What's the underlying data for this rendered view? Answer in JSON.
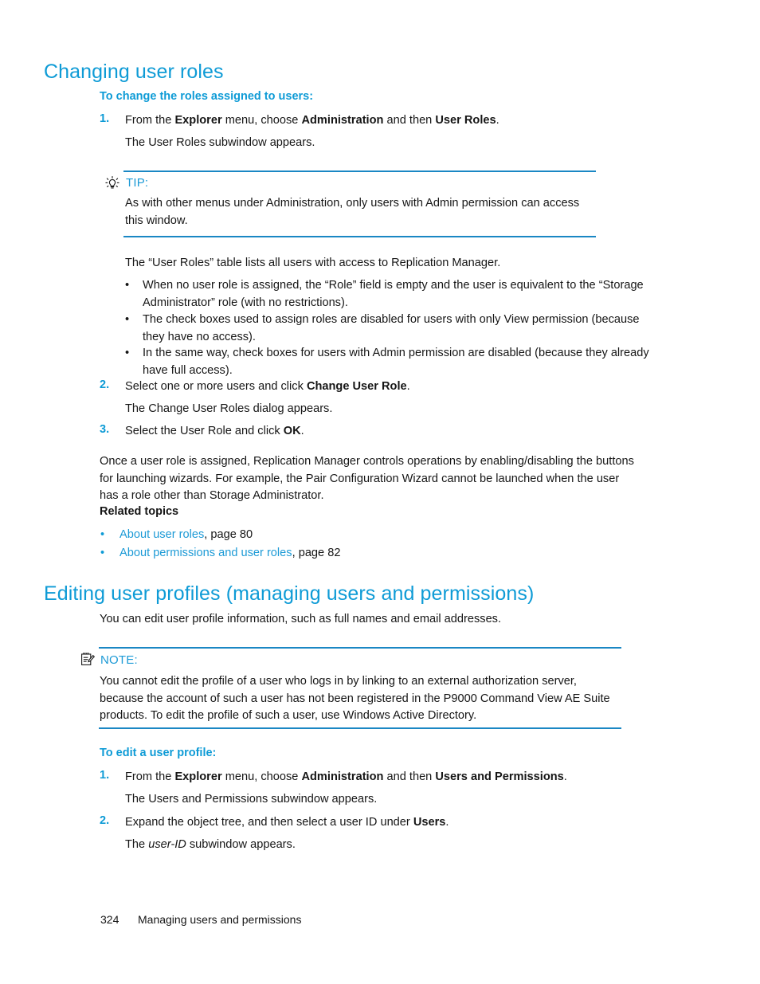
{
  "section1": {
    "heading": "Changing user roles",
    "procedure_heading": "To change the roles assigned to users:",
    "step1": {
      "number": "1.",
      "lead": "From the ",
      "bold1": "Explorer",
      "mid1": " menu, choose ",
      "bold2": "Administration",
      "mid2": " and then ",
      "bold3": "User Roles",
      "tail": ".",
      "result": "The User Roles subwindow appears."
    },
    "tip": {
      "icon": "lightbulb-icon",
      "label": "TIP:",
      "body": "As with other menus under Administration, only users with Admin permission can access this window."
    },
    "intro": "The “User Roles” table lists all users with access to Replication Manager.",
    "bullets": [
      "When no user role is assigned, the “Role” field is empty and the user is equivalent to the “Storage Administrator” role (with no restrictions).",
      "The check boxes used to assign roles are disabled for users with only View permission (because they have no access).",
      "In the same way, check boxes for users with Admin permission are disabled (because they already have full access)."
    ],
    "step2": {
      "number": "2.",
      "lead": "Select one or more users and click ",
      "bold1": "Change User Role",
      "tail": ".",
      "result": "The Change User Roles dialog appears."
    },
    "step3": {
      "number": "3.",
      "lead": "Select the User Role and click ",
      "bold1": "OK",
      "tail": "."
    },
    "closing_paragraph": "Once a user role is assigned, Replication Manager controls operations by enabling/disabling the buttons for launching wizards. For example, the Pair Configuration Wizard cannot be launched when the user has a role other than Storage Administrator.",
    "related_topics": {
      "heading": "Related topics",
      "items": [
        {
          "link": "About user roles",
          "page": ", page 80"
        },
        {
          "link": "About permissions and user roles",
          "page": ", page 82"
        }
      ]
    }
  },
  "section2": {
    "heading": "Editing user profiles (managing users and permissions)",
    "intro": "You can edit user profile information, such as full names and email addresses.",
    "note": {
      "icon": "notepad-pen-icon",
      "label": "NOTE:",
      "body": "You cannot edit the profile of a user who logs in by linking to an external authorization server, because the account of such a user has not been registered in the P9000 Command View AE Suite products. To edit the profile of such a user, use Windows Active Directory."
    },
    "procedure_heading": "To edit a user profile:",
    "step1": {
      "number": "1.",
      "lead": "From the ",
      "bold1": "Explorer",
      "mid1": " menu, choose ",
      "bold2": "Administration",
      "mid2": " and then ",
      "bold3": "Users and Permissions",
      "tail": ".",
      "result": "The Users and Permissions subwindow appears."
    },
    "step2": {
      "number": "2.",
      "lead": "Expand the object tree, and then select a user ID under ",
      "bold1": "Users",
      "tail": ".",
      "result_pre": "The ",
      "result_italic": "user-ID",
      "result_post": " subwindow appears."
    }
  },
  "footer": {
    "page_number": "324",
    "running_title": "Managing users and permissions"
  },
  "colors": {
    "heading_blue": "#0e9bd6",
    "link_blue": "#1c9ad6",
    "rule_blue": "#1a87c4",
    "body_black": "#161616"
  }
}
